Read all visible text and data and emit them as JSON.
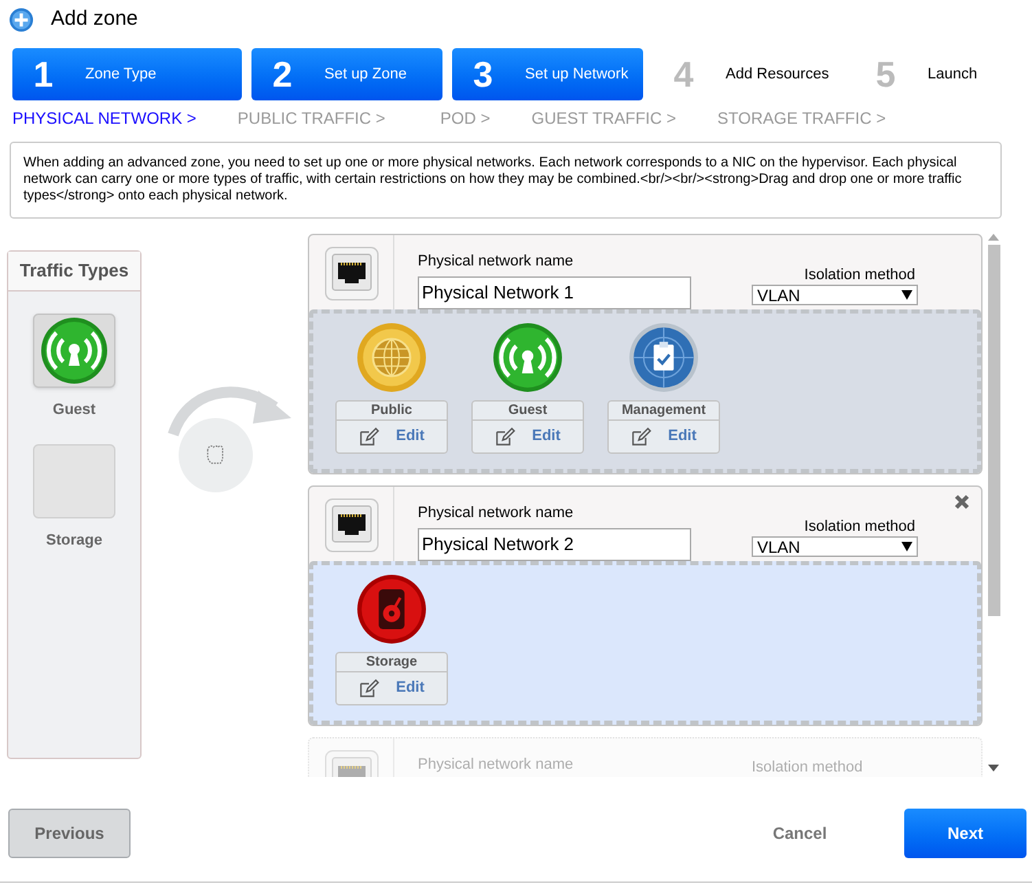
{
  "window": {
    "title": "Add zone"
  },
  "steps": [
    {
      "number": "1",
      "label": "Zone Type",
      "reached": true
    },
    {
      "number": "2",
      "label": "Set up Zone",
      "reached": true
    },
    {
      "number": "3",
      "label": "Set up Network",
      "reached": true
    },
    {
      "number": "4",
      "label": "Add Resources",
      "reached": false
    },
    {
      "number": "5",
      "label": "Launch",
      "reached": false
    }
  ],
  "substeps": [
    {
      "label": "PHYSICAL NETWORK >",
      "selected": true
    },
    {
      "label": "PUBLIC TRAFFIC >",
      "selected": false
    },
    {
      "label": "POD >",
      "selected": false
    },
    {
      "label": "GUEST TRAFFIC >",
      "selected": false
    },
    {
      "label": "STORAGE TRAFFIC >",
      "selected": false
    }
  ],
  "description": "When adding an advanced zone, you need to set up one or more physical networks. Each network corresponds to a NIC on the hypervisor. Each physical network can carry one or more types of traffic, with certain restrictions on how they may be combined.<br/><br/><strong>Drag and drop one or more traffic types</strong> onto each physical network.",
  "traffic_types": {
    "title": "Traffic Types",
    "items": [
      {
        "kind": "guest",
        "label": "Guest",
        "placed": false
      },
      {
        "label": "Storage",
        "placed": true
      }
    ]
  },
  "networks": [
    {
      "name_label": "Physical network name",
      "name": "Physical Network 1",
      "isolation_label": "Isolation method",
      "isolation": "VLAN",
      "removable": false,
      "highlighted": false,
      "disabled": false,
      "traffic": [
        {
          "kind": "public",
          "label": "Public",
          "edit": "Edit"
        },
        {
          "kind": "guest",
          "label": "Guest",
          "edit": "Edit"
        },
        {
          "kind": "management",
          "label": "Management",
          "edit": "Edit"
        }
      ]
    },
    {
      "name_label": "Physical network name",
      "name": "Physical Network 2",
      "isolation_label": "Isolation method",
      "isolation": "VLAN",
      "removable": true,
      "highlighted": true,
      "disabled": false,
      "traffic": [
        {
          "kind": "storage",
          "label": "Storage",
          "edit": "Edit"
        }
      ]
    },
    {
      "name_label": "Physical network name",
      "isolation_label": "Isolation method",
      "removable": false,
      "disabled": true
    }
  ],
  "buttons": {
    "previous": "Previous",
    "cancel": "Cancel",
    "next": "Next"
  }
}
